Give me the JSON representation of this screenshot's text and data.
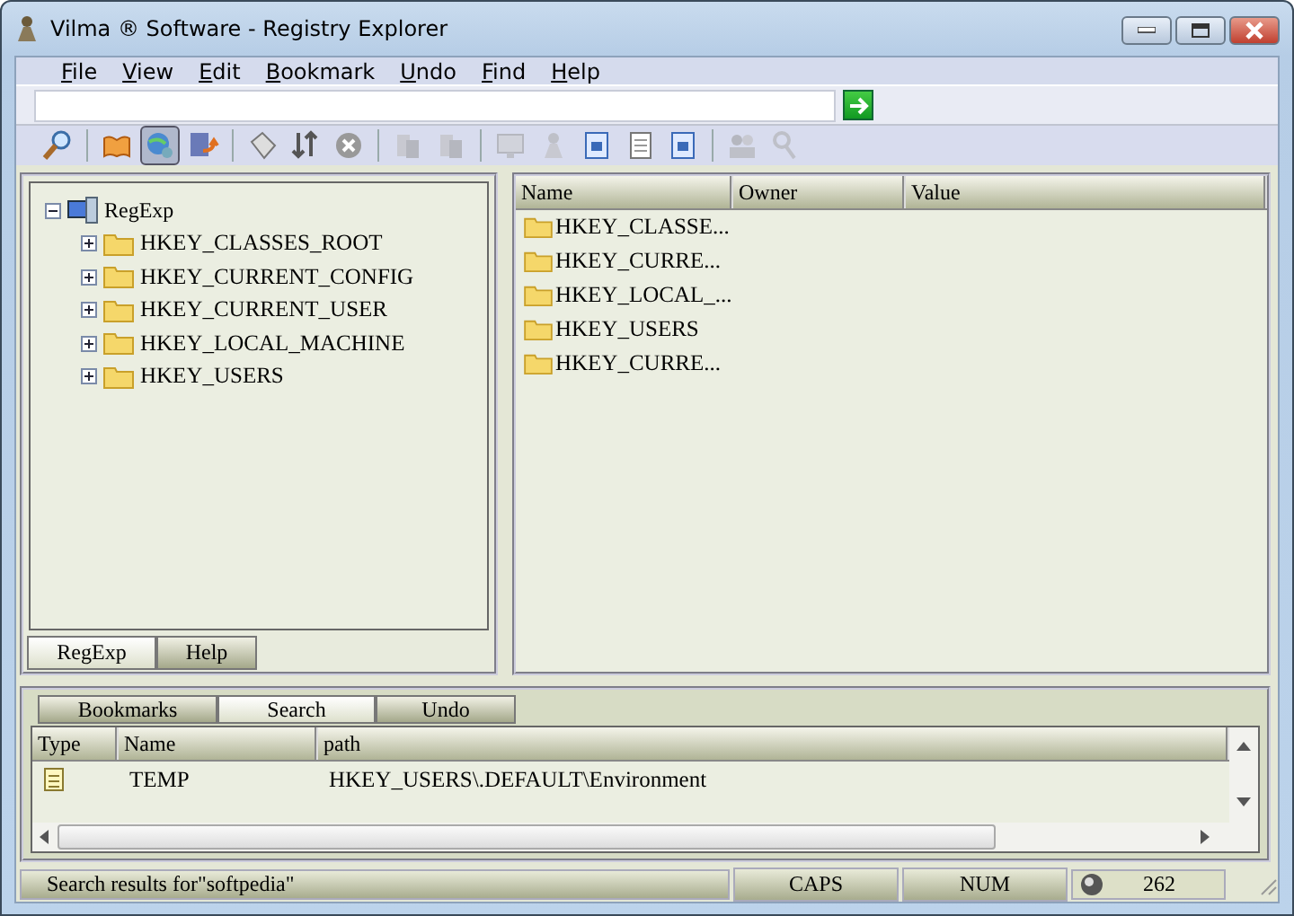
{
  "window": {
    "title": "Vilma ® Software - Registry Explorer"
  },
  "menu": [
    "File",
    "View",
    "Edit",
    "Bookmark",
    "Undo",
    "Find",
    "Help"
  ],
  "toolbar": [
    {
      "kind": "button",
      "disabled": false,
      "pressed": false
    },
    {
      "kind": "separator"
    },
    {
      "kind": "button",
      "disabled": false,
      "pressed": false
    },
    {
      "kind": "button",
      "disabled": false,
      "pressed": true
    },
    {
      "kind": "button",
      "disabled": false,
      "pressed": false
    },
    {
      "kind": "separator"
    },
    {
      "kind": "button",
      "disabled": false,
      "pressed": false
    },
    {
      "kind": "button",
      "disabled": false,
      "pressed": false
    },
    {
      "kind": "button",
      "disabled": false,
      "pressed": false
    },
    {
      "kind": "separator"
    },
    {
      "kind": "button",
      "disabled": true,
      "pressed": false
    },
    {
      "kind": "button",
      "disabled": true,
      "pressed": false
    },
    {
      "kind": "separator"
    },
    {
      "kind": "button",
      "disabled": true,
      "pressed": false
    },
    {
      "kind": "button",
      "disabled": true,
      "pressed": false
    },
    {
      "kind": "button",
      "disabled": false,
      "pressed": false
    },
    {
      "kind": "button",
      "disabled": false,
      "pressed": false
    },
    {
      "kind": "button",
      "disabled": false,
      "pressed": false
    },
    {
      "kind": "separator"
    },
    {
      "kind": "button",
      "disabled": true,
      "pressed": false
    },
    {
      "kind": "button",
      "disabled": true,
      "pressed": false
    }
  ],
  "tree": [
    {
      "label": "RegExp",
      "expanded": true,
      "children": [
        {
          "label": "HKEY_CLASSES_ROOT",
          "expanded": false
        },
        {
          "label": "HKEY_CURRENT_CONFIG",
          "expanded": false
        },
        {
          "label": "HKEY_CURRENT_USER",
          "expanded": false
        },
        {
          "label": "HKEY_LOCAL_MACHINE",
          "expanded": false
        },
        {
          "label": "HKEY_USERS",
          "expanded": false
        }
      ]
    }
  ],
  "left_tabs": [
    {
      "label": "RegExp",
      "selected": true
    },
    {
      "label": "Help",
      "selected": false
    }
  ],
  "list": {
    "columns": [
      "Name",
      "Owner",
      "Value"
    ],
    "rows": [
      {
        "name": "HKEY_CLASSE..."
      },
      {
        "name": "HKEY_CURRE..."
      },
      {
        "name": "HKEY_LOCAL_..."
      },
      {
        "name": "HKEY_USERS"
      },
      {
        "name": "HKEY_CURRE..."
      }
    ]
  },
  "bottom_tabs": [
    {
      "label": "Bookmarks",
      "selected": false
    },
    {
      "label": "Search",
      "selected": true
    },
    {
      "label": "Undo",
      "selected": false
    }
  ],
  "results": {
    "columns": [
      "Type",
      "Name",
      "path"
    ],
    "rows": [
      {
        "name": "TEMP",
        "path": "HKEY_USERS\\.DEFAULT\\Environment"
      }
    ]
  },
  "status_bar": {
    "message": "Search results for\"softpedia\"",
    "caps": "CAPS",
    "num": "NUM",
    "count": "262"
  }
}
